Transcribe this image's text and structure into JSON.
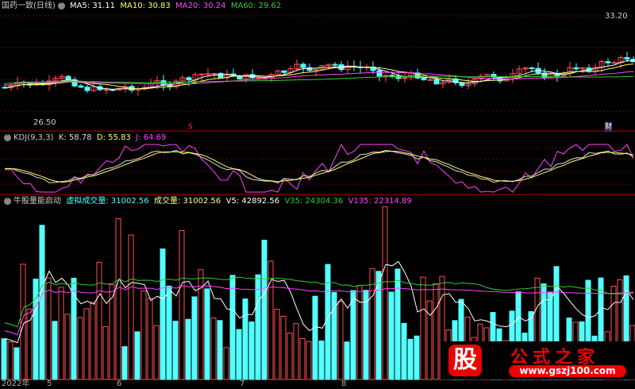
{
  "main": {
    "title": "国药一致(日线)",
    "ma5": "MA5: 31.11",
    "ma10": "MA10: 30.83",
    "ma20": "MA20: 30.24",
    "ma60": "MA60: 29.62",
    "high_label": "33.20",
    "low_label": "26.50",
    "marker_s": "S",
    "marker_cai": "财"
  },
  "kdj": {
    "title": "KDJ(9,3,3)",
    "k": "K: 58.78",
    "d": "D: 55.83",
    "j": "J: 64.69"
  },
  "vol": {
    "title": "牛股量能启动",
    "virtual": "虚拟成交量: 31002.56",
    "volume": "成交量: 31002.56",
    "v5": "V5: 42892.56",
    "v35": "V35: 24304.36",
    "v135": "V135: 22314.89"
  },
  "axis": {
    "labels": [
      "2022年",
      "5",
      "6",
      "7",
      "8"
    ]
  },
  "watermark": {
    "logo": "股",
    "name": "公式之家",
    "url": "www.gszj100.com"
  },
  "colors": {
    "up": "#ff5050",
    "down": "#54ffff",
    "ma5": "#ffffff",
    "ma10": "#ffff66",
    "ma20": "#ff44ff",
    "ma60": "#33cc33",
    "grid": "#7a0000"
  }
}
